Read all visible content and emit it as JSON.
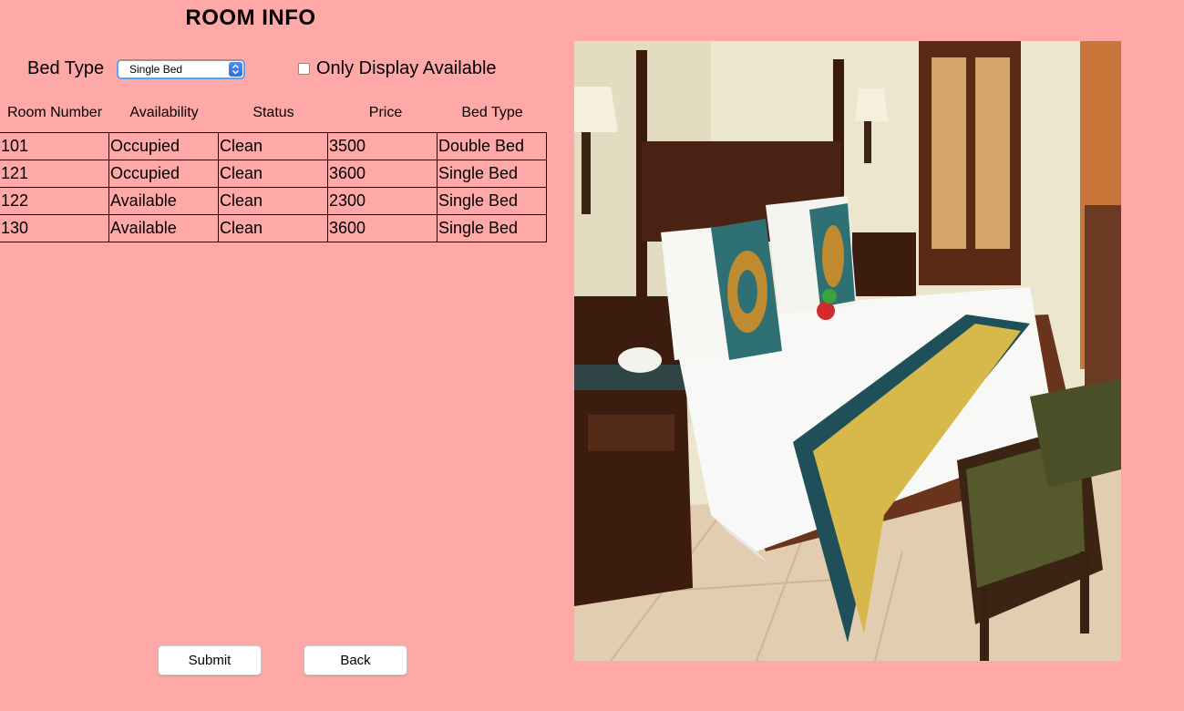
{
  "window": {
    "title": "ROOM INFO"
  },
  "filter": {
    "label": "Bed Type",
    "selected": "Single Bed",
    "only_available_label": "Only Display Available",
    "only_available_checked": false
  },
  "table": {
    "columns": [
      "Room Number",
      "Availability",
      "Status",
      "Price",
      "Bed Type"
    ],
    "rows": [
      [
        "101",
        "Occupied",
        "Clean",
        "3500",
        "Double Bed"
      ],
      [
        "121",
        "Occupied",
        "Clean",
        "3600",
        "Single Bed"
      ],
      [
        "122",
        "Available",
        "Clean",
        "2300",
        "Single Bed"
      ],
      [
        "130",
        "Available",
        "Clean",
        "3600",
        "Single Bed"
      ]
    ]
  },
  "buttons": {
    "submit": "Submit",
    "back": "Back"
  },
  "colors": {
    "background": "#ffa8a8",
    "accent": "#2a6fe0"
  },
  "image": {
    "subject": "hotel-room-photo"
  }
}
